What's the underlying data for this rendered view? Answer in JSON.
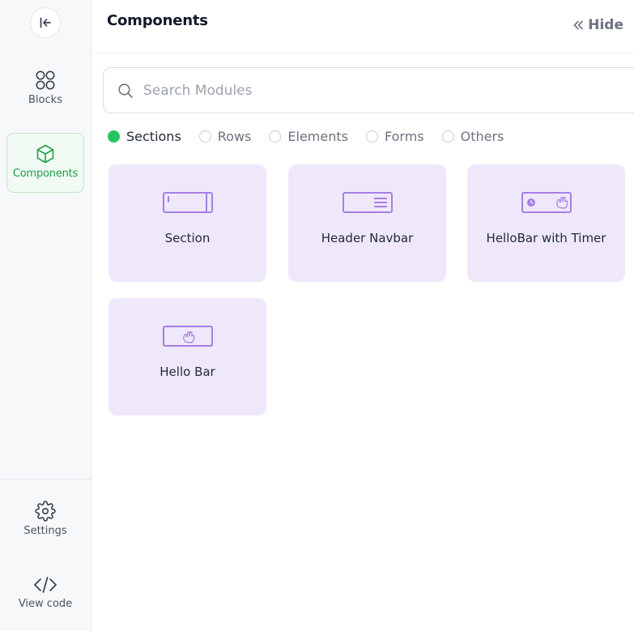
{
  "rail": {
    "items": [
      {
        "label": "Blocks",
        "icon": "blocks-icon"
      },
      {
        "label": "Components",
        "icon": "cube-icon",
        "active": true
      }
    ],
    "bottom_items": [
      {
        "label": "Settings",
        "icon": "gear-icon"
      },
      {
        "label": "View code",
        "icon": "code-icon"
      }
    ]
  },
  "header": {
    "title": "Components",
    "hide_label": "Hide"
  },
  "search": {
    "placeholder": "Search Modules",
    "value": ""
  },
  "filters": [
    {
      "label": "Sections",
      "selected": true
    },
    {
      "label": "Rows",
      "selected": false
    },
    {
      "label": "Elements",
      "selected": false
    },
    {
      "label": "Forms",
      "selected": false
    },
    {
      "label": "Others",
      "selected": false
    }
  ],
  "cards": [
    {
      "title": "Section",
      "icon": "section-icon"
    },
    {
      "title": "Header Navbar",
      "icon": "navbar-icon"
    },
    {
      "title": "HelloBar with Timer",
      "icon": "hellobar-timer-icon"
    },
    {
      "title": "Hello Bar",
      "icon": "hellobar-icon"
    }
  ],
  "colors": {
    "accent_green": "#22c55e",
    "card_bg": "#efe8fb",
    "card_icon": "#a67ee3"
  }
}
